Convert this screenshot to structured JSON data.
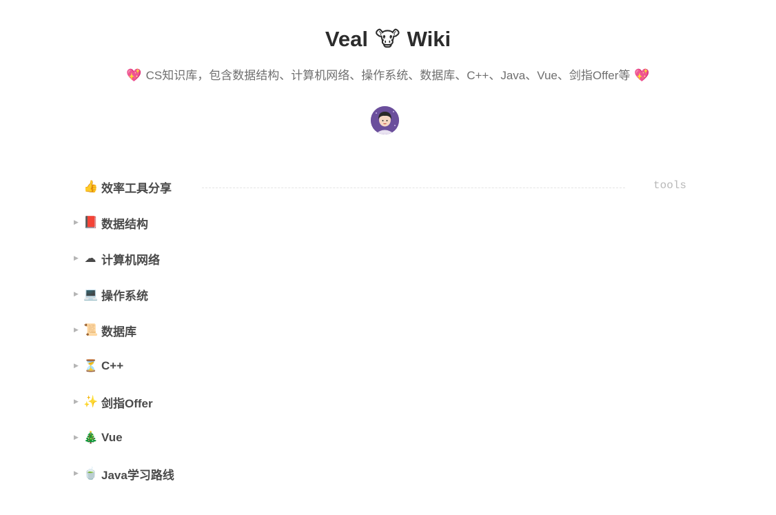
{
  "header": {
    "title_left": "Veal",
    "title_emoji": "🐮",
    "title_right": "Wiki",
    "subtitle_icon": "💖",
    "subtitle": "CS知识库，包含数据结构、计算机网络、操作系统、数据库、C++、Java、Vue、剑指Offer等",
    "avatar_icon": "avatar"
  },
  "tools_tag": "tools",
  "items": [
    {
      "icon": "👍",
      "label": "效率工具分享"
    },
    {
      "icon": "📕",
      "label": "数据结构"
    },
    {
      "icon": "☁",
      "label": "计算机网络"
    },
    {
      "icon": "💻",
      "label": "操作系统"
    },
    {
      "icon": "📜",
      "label": "数据库"
    },
    {
      "icon": "⏳",
      "label": "C++"
    },
    {
      "icon": "✨",
      "label": "剑指Offer"
    },
    {
      "icon": "🎄",
      "label": "Vue"
    },
    {
      "icon": "🍵",
      "label": "Java学习路线"
    }
  ],
  "colors": {
    "accent_heart": "#e0245e",
    "text_muted": "#6f6f6f"
  }
}
